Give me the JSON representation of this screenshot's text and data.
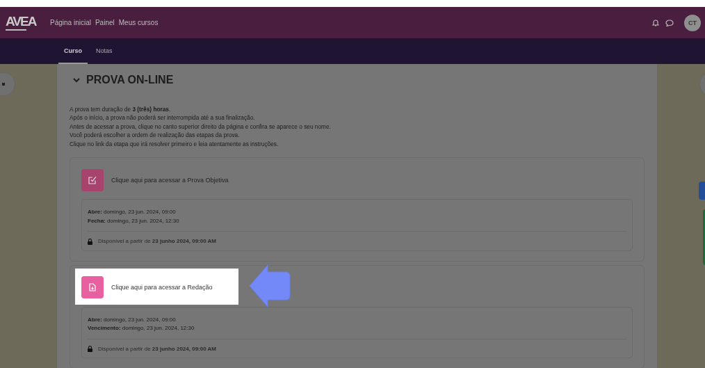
{
  "header": {
    "logo_text": "AVEA",
    "nav": [
      "Página inicial",
      "Painel",
      "Meus cursos"
    ],
    "avatar_initials": "CT"
  },
  "tabs": [
    {
      "label": "Curso",
      "selected": true
    },
    {
      "label": "Notas",
      "selected": false
    }
  ],
  "section": {
    "title": "PROVA ON-LINE",
    "expanded": true,
    "intro": [
      "A prova tem duração de **3 (três) horas**.",
      "Após o início, a prova não poderá ser interrompida até a sua finalização.",
      "Antes de acessar a prova, clique no canto superior direito da página e confira se aparece o seu nome.",
      "Você poderá escolher a ordem de realização das etapas da prova.",
      "Clique no link da etapa que irá resolver primeiro e leia atentamente as instruções."
    ],
    "activities": [
      {
        "kind": "quiz",
        "name": "Clique aqui para acessar a Prova Objetiva",
        "highlighted": false,
        "dates": [
          "**Abre:** domingo, 23 jun. 2024, 09:00",
          "**Fecha:** domingo, 23 jun. 2024, 12:30"
        ],
        "restriction": "Disponível a partir de **23 junho 2024, 09:00 AM**"
      },
      {
        "kind": "assignment",
        "name": "Clique aqui para acessar a Redação",
        "highlighted": true,
        "dates": [
          "**Abre:** domingo, 23 jun. 2024, 09:00",
          "**Vencimento:** domingo, 23 jun. 2024, 12:30"
        ],
        "restriction": "Disponível a partir de **23 junho 2024, 09:00 AM**"
      }
    ]
  }
}
